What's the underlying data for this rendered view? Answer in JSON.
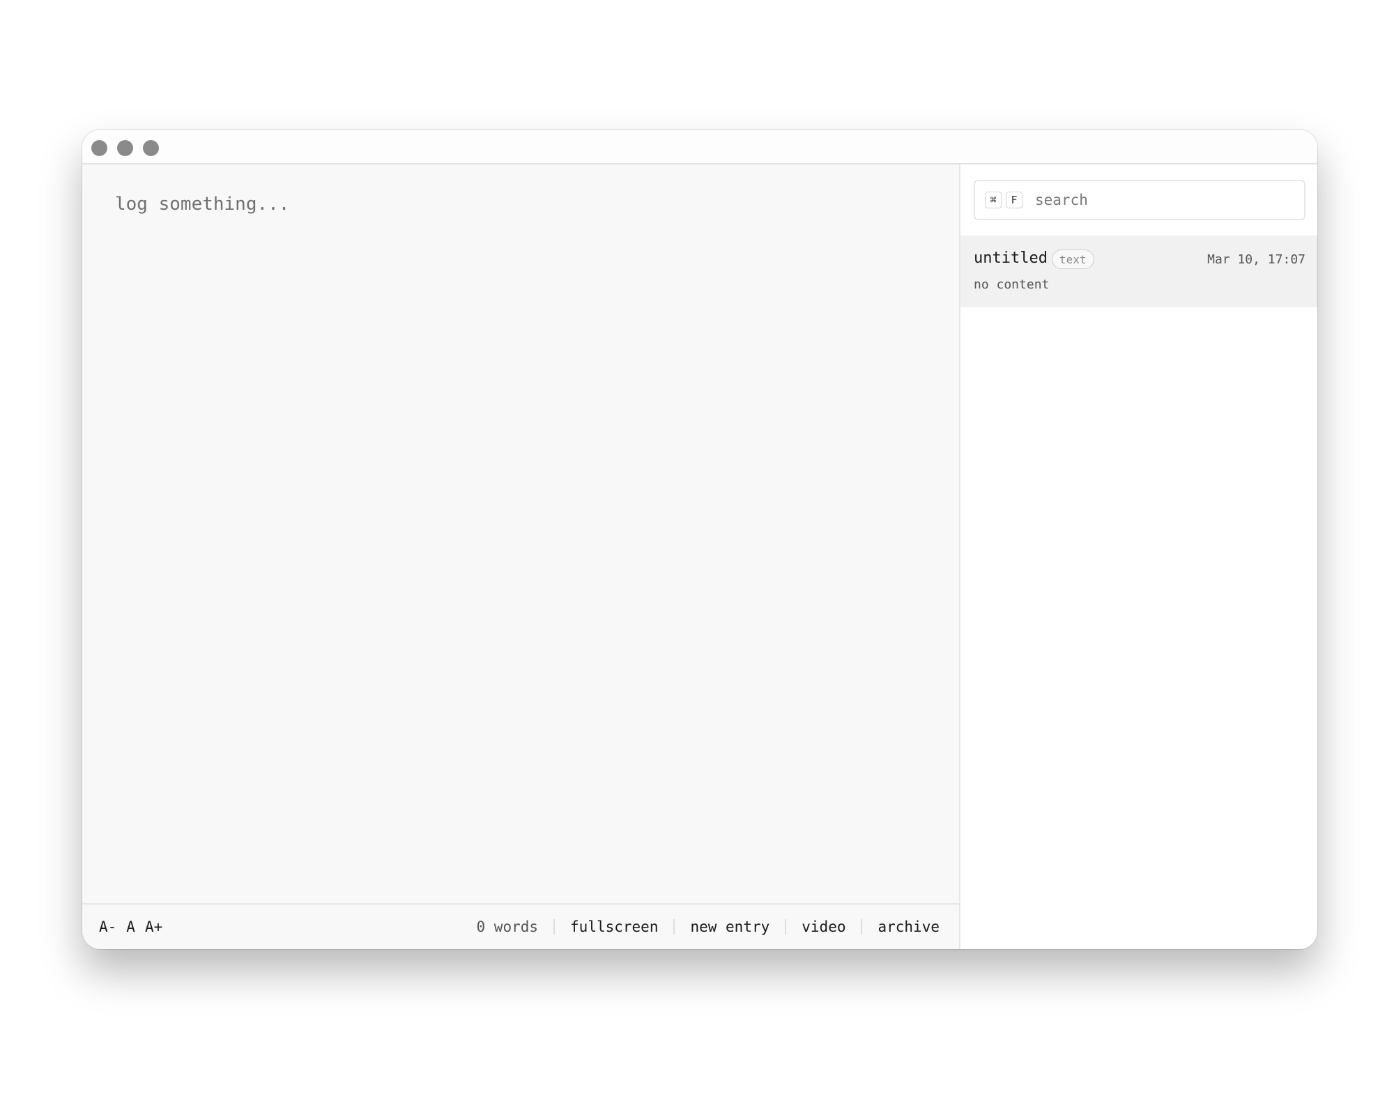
{
  "editor": {
    "placeholder": "log something..."
  },
  "bottombar": {
    "font_decrease": "A-",
    "font_reset": "A",
    "font_increase": "A+",
    "word_count": "0 words",
    "fullscreen": "fullscreen",
    "new_entry": "new entry",
    "video": "video",
    "archive": "archive"
  },
  "sidebar": {
    "search": {
      "shortcut_key1": "⌘",
      "shortcut_key2": "F",
      "placeholder": "search"
    },
    "entries": [
      {
        "title": "untitled",
        "badge": "text",
        "date": "Mar 10, 17:07",
        "preview": "no content"
      }
    ]
  }
}
